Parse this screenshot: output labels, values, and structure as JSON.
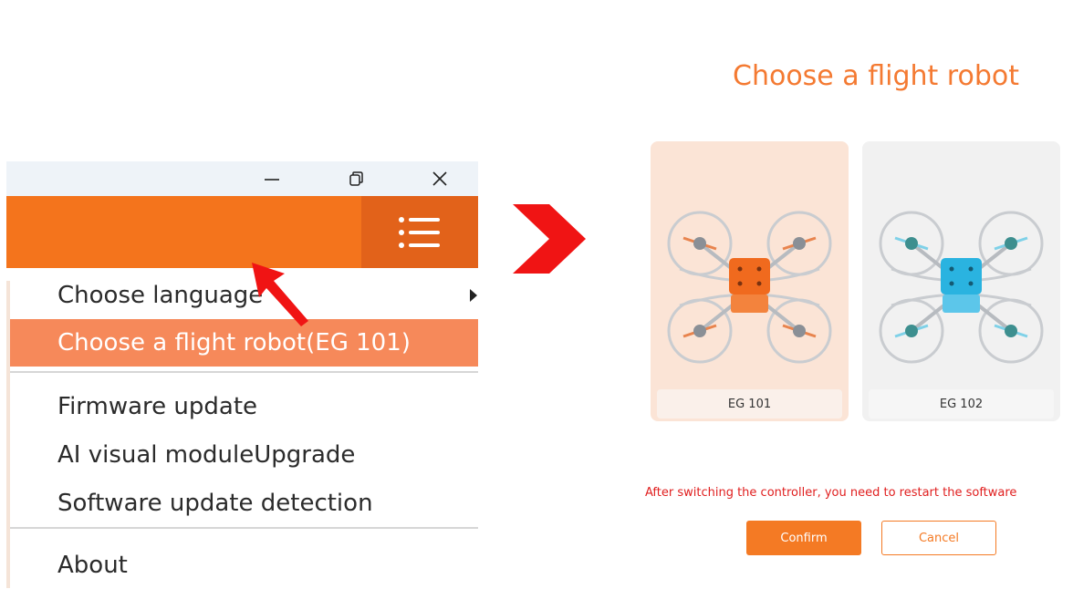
{
  "window": {
    "controls": {
      "minimize_icon": "minimize-icon",
      "restore_icon": "restore-icon",
      "close_icon": "close-icon"
    },
    "menu_icon": "menu-list-icon",
    "accent_color": "#f4741c"
  },
  "menu": {
    "items": [
      {
        "label": "Choose language",
        "submenu": true
      },
      {
        "label": "Choose a flight robot(EG 101)",
        "active": true
      },
      {
        "label": "Firmware update"
      },
      {
        "label": "AI visual moduleUpgrade"
      },
      {
        "label": "Software update detection"
      },
      {
        "label": "About"
      }
    ]
  },
  "dialog": {
    "title": "Choose a flight robot",
    "robots": [
      {
        "label": "EG 101",
        "color": "#f06a1e",
        "selected": true
      },
      {
        "label": "EG 102",
        "color": "#2ab3e0",
        "selected": false
      }
    ],
    "warning": "After switching the controller, you need to restart the software",
    "confirm_label": "Confirm",
    "cancel_label": "Cancel",
    "warning_color": "#e01e1e"
  }
}
